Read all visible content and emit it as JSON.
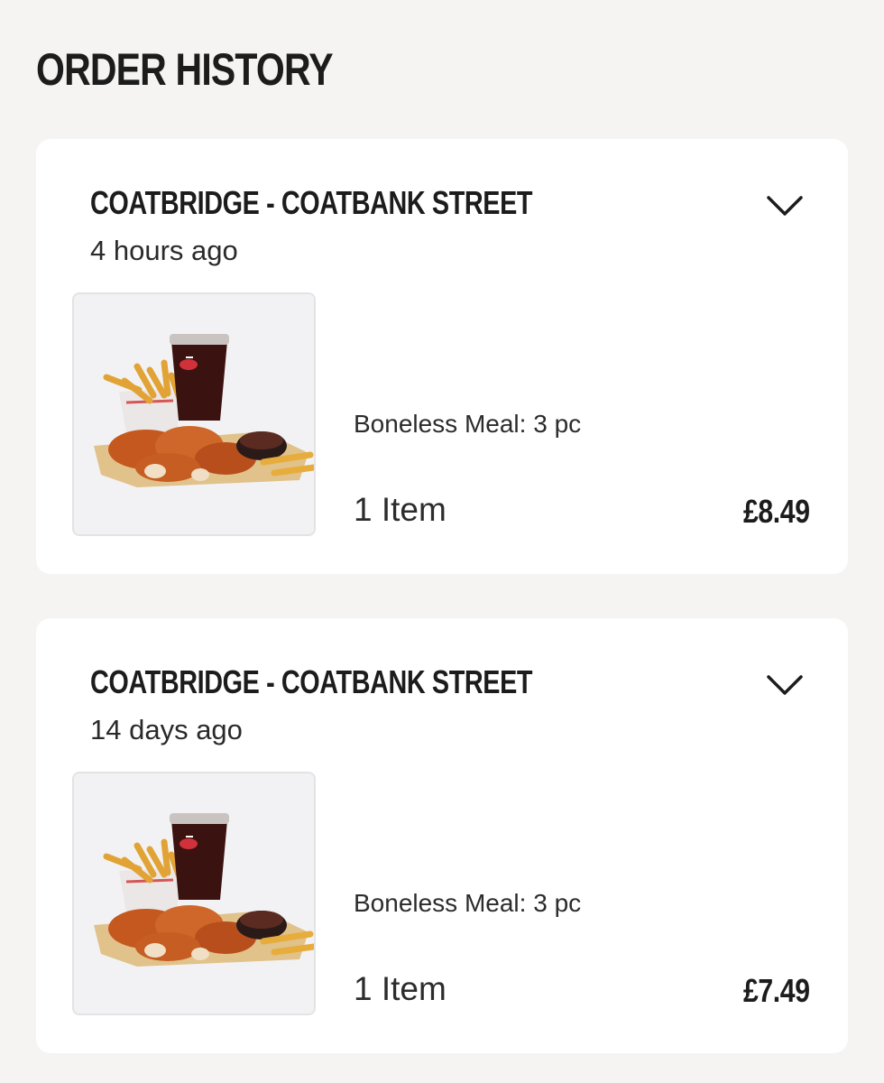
{
  "page": {
    "title": "ORDER HISTORY"
  },
  "orders": [
    {
      "store": "COATBRIDGE - COATBANK STREET",
      "time_ago": "4 hours ago",
      "product": "Boneless Meal: 3 pc",
      "item_count": "1 Item",
      "price": "£8.49",
      "toggle_icon": "chevron-down-icon",
      "thumbnail": "boneless-meal-image"
    },
    {
      "store": "COATBRIDGE - COATBANK STREET",
      "time_ago": "14 days ago",
      "product": "Boneless Meal: 3 pc",
      "item_count": "1 Item",
      "price": "£7.49",
      "toggle_icon": "chevron-down-icon",
      "thumbnail": "boneless-meal-image"
    }
  ],
  "colors": {
    "page_background": "#f5f4f3",
    "card_background": "#ffffff",
    "text_primary": "#1c1c1c"
  }
}
